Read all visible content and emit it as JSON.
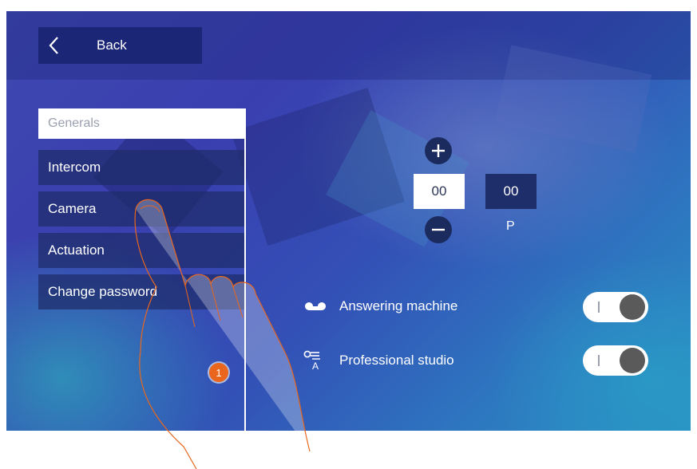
{
  "header": {
    "back_label": "Back"
  },
  "menu": {
    "items": [
      {
        "label": "Generals",
        "active": true
      },
      {
        "label": "Intercom"
      },
      {
        "label": "Camera"
      },
      {
        "label": "Actuation"
      },
      {
        "label": "Change password"
      }
    ]
  },
  "address": {
    "main_value": "00",
    "secondary_value": "00",
    "secondary_label": "P"
  },
  "settings": [
    {
      "label": "Answering machine",
      "icon": "answering-machine-icon",
      "toggle_text": "I"
    },
    {
      "label": "Professional studio",
      "icon": "professional-studio-icon",
      "toggle_text": "I"
    }
  ],
  "callout": {
    "step_number": "1"
  },
  "colors": {
    "accent_orange": "#e9661c",
    "button_dark": "#1c2b5e"
  }
}
